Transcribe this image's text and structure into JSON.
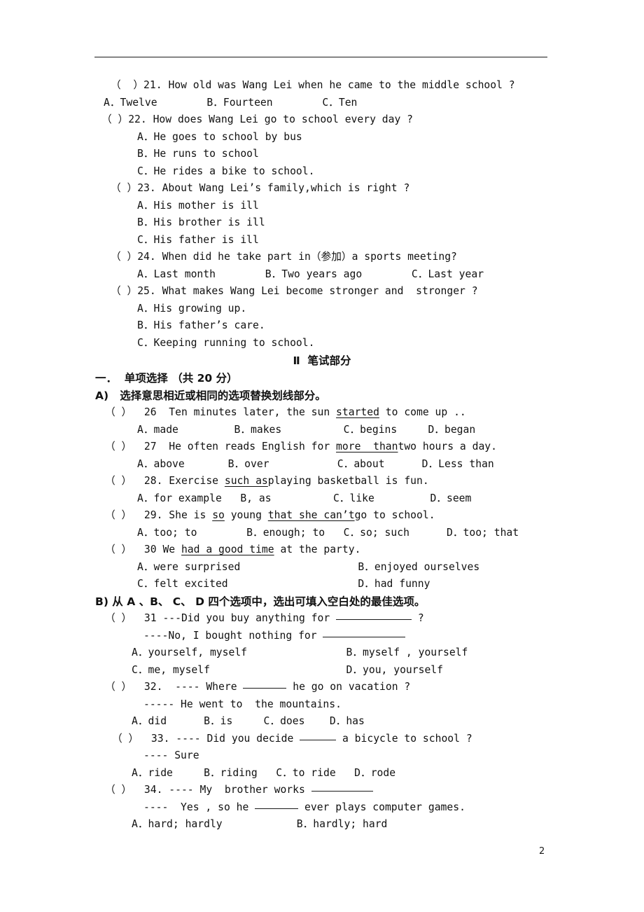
{
  "page": {
    "number": "2",
    "has_header_rule": true
  },
  "listening_questions": [
    {
      "marker": "（  ）21.",
      "stem": "How old was Wang Lei when he came to the middle school ?",
      "options_inline": "A．Twelve        B．Fourteen        C．Ten"
    },
    {
      "marker": "（ ）22.",
      "stem": "How does Wang Lei go to school every day ?",
      "options": [
        "A．He goes to school by bus",
        "B．He runs to school",
        "C．He rides a bike to school."
      ]
    },
    {
      "marker": "（ ）23.",
      "stem": "About Wang Lei’s family,which is right ?",
      "options": [
        "A．His mother is ill",
        "B．His brother is ill",
        "C．His father is ill"
      ]
    },
    {
      "marker": "（ ）24.",
      "stem": "When did he take part in（参加）a sports meeting?",
      "options_inline": "A．Last month        B．Two years ago        C．Last year"
    },
    {
      "marker": "（ ）25.",
      "stem": "What makes Wang Lei become stronger and  stronger ?",
      "options": [
        "A．His growing up.",
        "B．His father’s care.",
        "C．Keeping running to school."
      ]
    }
  ],
  "section_heading": "Ⅱ  笔试部分",
  "part_one_heading": "一．  单项选择 （共 20 分）",
  "part_a_heading": "A)   选择意思相近或相同的选项替换划线部分。",
  "part_b_heading": "B) 从 A 、B、 C、 D 四个选项中，选出可填入空白处的最佳选项。",
  "part_a_questions": [
    {
      "marker": "（ ）",
      "number": "26",
      "stem_before": "Ten minutes later, the sun ",
      "underlined": "started",
      "stem_after": " to come up ..",
      "options_inline": "A．made         B．makes          C．begins     D．began"
    },
    {
      "marker": "（ ）",
      "number": "27",
      "stem_before": "He often reads English for ",
      "underlined": "more  than",
      "stem_after": "two hours a day.",
      "options_inline": "A．above       B．over           C．about      D．Less than"
    },
    {
      "marker": "（ ）",
      "number": "28.",
      "stem_before": "Exercise ",
      "underlined": "such as",
      "stem_after": "playing basketball is fun.",
      "options_inline": "A．for example   B, as          C．like         D．seem"
    },
    {
      "marker": "（ ）",
      "number": "29.",
      "stem_before": "She is ",
      "underlined": "so",
      "stem_mid": " young ",
      "underlined2": "that she can’t",
      "stem_after": "go to school.",
      "options_inline": "A．too; to        B．enough; to   C．so; such      D．too; that"
    },
    {
      "marker": "（ ）",
      "number": "30",
      "stem_before": "We ",
      "underlined": "had a good time",
      "stem_after": " at the party.",
      "options_two_line": [
        "A．were surprised                   B．enjoyed ourselves",
        "C．felt excited                     D．had funny"
      ]
    }
  ],
  "part_b_questions": [
    {
      "marker": "（ ）",
      "number": "31",
      "line1_before": "---Did you buy anything for ",
      "line1_after": " ?",
      "line2_before": "----No, I bought nothing for ",
      "line2_after": "",
      "options_two_line": [
        "A．yourself, myself                B．myself , yourself",
        "C．me, myself                      D．you, yourself"
      ]
    },
    {
      "marker": "（ ）",
      "number": "32.",
      "line1_before": "---- Where ",
      "line1_after": " he go on vacation ?",
      "line2": "----- He went to  the mountains.",
      "options_inline": "A．did      B．is     C．does    D．has"
    },
    {
      "marker": "（ ）",
      "number": "33.",
      "line1_before": "---- Did you decide ",
      "line1_after": " a bicycle to school ?",
      "line2": "---- Sure",
      "options_inline": "A．ride     B．riding   C．to ride   D．rode"
    },
    {
      "marker": "（ ）",
      "number": "34.",
      "line1_before": "---- My  brother works ",
      "line1_after": "",
      "line2_before": "----  Yes , so he ",
      "line2_after": " ever plays computer games.",
      "options_inline": "A．hard; hardly            B．hardly; hard"
    }
  ]
}
